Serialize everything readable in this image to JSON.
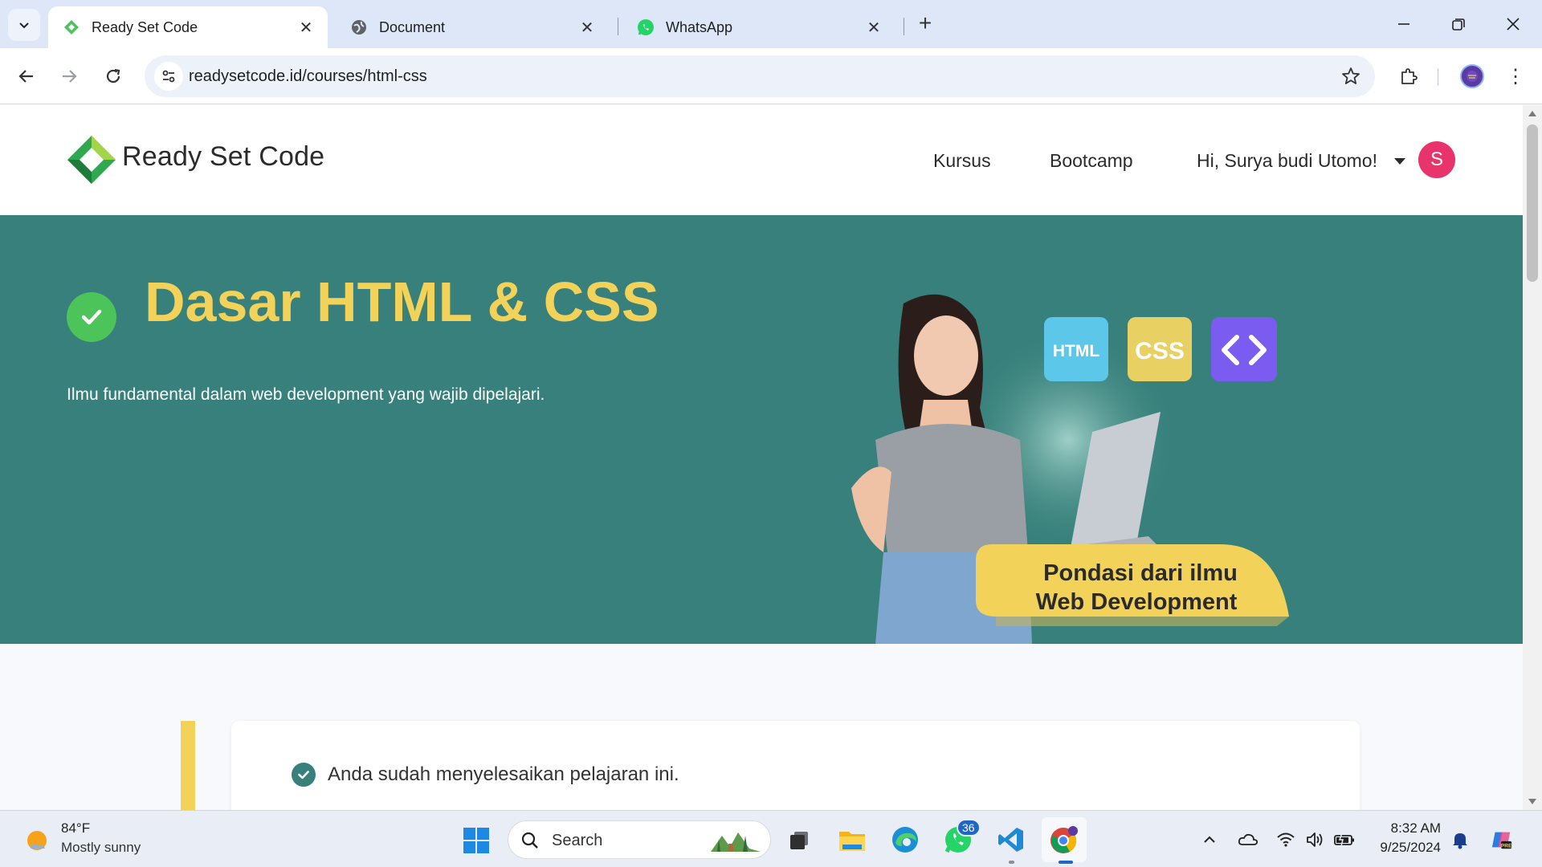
{
  "browser": {
    "tabs": [
      {
        "title": "Ready Set Code",
        "active": true
      },
      {
        "title": "Document",
        "active": false
      },
      {
        "title": "WhatsApp",
        "active": false
      }
    ],
    "url": "readysetcode.id/courses/html-css"
  },
  "site": {
    "brand": "Ready Set Code",
    "nav": {
      "courses": "Kursus",
      "bootcamp": "Bootcamp",
      "greeting": "Hi, Surya budi Utomo!",
      "avatar_letter": "S"
    },
    "hero": {
      "title": "Dasar HTML & CSS",
      "subtitle": "Ilmu fundamental dalam web development yang wajib dipelajari.",
      "art": {
        "badge_html": "HTML",
        "badge_css": "CSS",
        "banner_line1": "Pondasi dari ilmu",
        "banner_line2": "Web Development"
      }
    },
    "lesson_status": "Anda sudah menyelesaikan pelajaran ini.",
    "colors": {
      "hero_bg": "#37807b",
      "accent_yellow": "#f3d25a",
      "check_green": "#4cc45a",
      "avatar_pink": "#e8336d"
    }
  },
  "taskbar": {
    "weather": {
      "temp": "84°F",
      "desc": "Mostly sunny"
    },
    "search_label": "Search",
    "whatsapp_badge": "36",
    "time": "8:32 AM",
    "date": "9/25/2024"
  }
}
